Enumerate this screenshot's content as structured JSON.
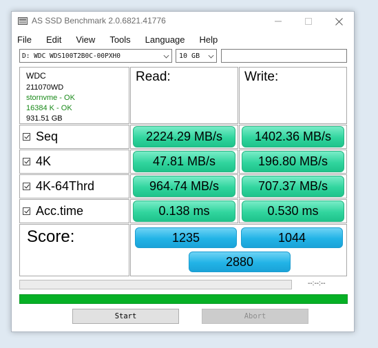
{
  "window": {
    "title": "AS SSD Benchmark 2.0.6821.41776"
  },
  "menu": [
    "File",
    "Edit",
    "View",
    "Tools",
    "Language",
    "Help"
  ],
  "toolbar": {
    "drive": "D: WDC WDS100T2B0C-00PXH0",
    "size": "10 GB",
    "text_value": ""
  },
  "info": {
    "vendor": "WDC",
    "firmware": "211070WD",
    "driver_status": "stornvme - OK",
    "alignment_status": "16384 K - OK",
    "capacity": "931.51 GB",
    "ok_color": "#1a8a1a"
  },
  "headers": {
    "read": "Read:",
    "write": "Write:"
  },
  "rows": [
    {
      "label": "Seq",
      "read": "2224.29 MB/s",
      "write": "1402.36 MB/s"
    },
    {
      "label": "4K",
      "read": "47.81 MB/s",
      "write": "196.80 MB/s"
    },
    {
      "label": "4K-64Thrd",
      "read": "964.74 MB/s",
      "write": "707.37 MB/s"
    },
    {
      "label": "Acc.time",
      "read": "0.138 ms",
      "write": "0.530 ms"
    }
  ],
  "score": {
    "label": "Score:",
    "read": "1235",
    "write": "1044",
    "total": "2880"
  },
  "status": {
    "time": "--:--:--",
    "progress": 0.0,
    "bar_color": "#06b025"
  },
  "buttons": {
    "start": "Start",
    "abort": "Abort"
  }
}
